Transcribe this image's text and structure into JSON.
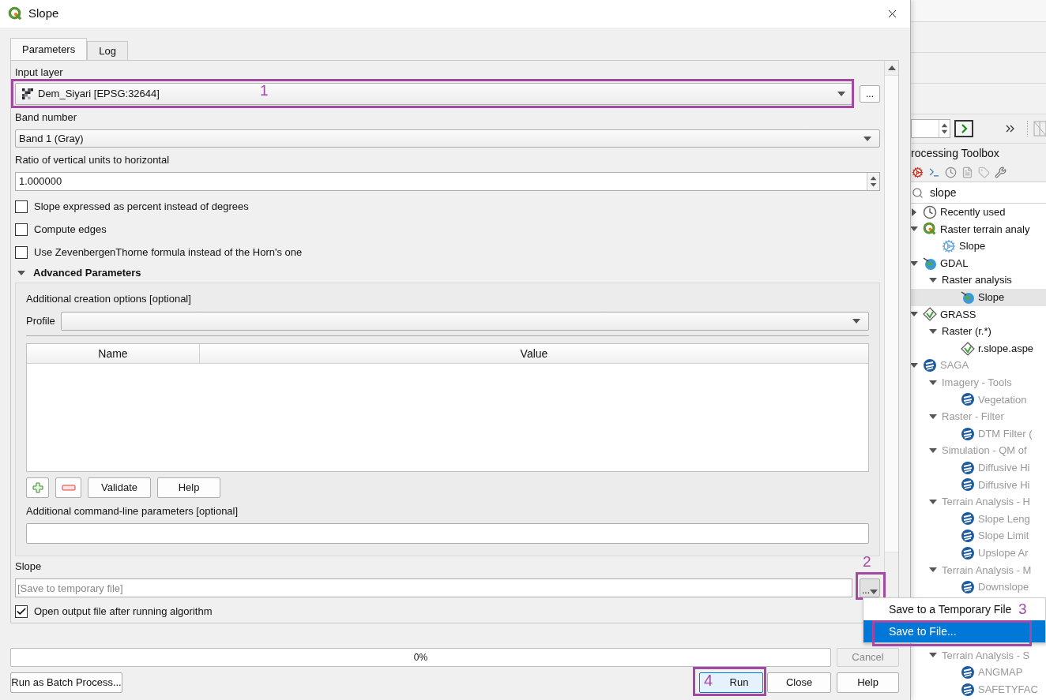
{
  "window": {
    "title": "Slope"
  },
  "tabs": [
    {
      "label": "Parameters",
      "selected": true
    },
    {
      "label": "Log",
      "selected": false
    }
  ],
  "input_layer": {
    "label": "Input layer",
    "value": "Dem_Siyari [EPSG:32644]",
    "button": "...",
    "annotation": "1"
  },
  "band": {
    "label": "Band number",
    "value": "Band 1 (Gray)"
  },
  "ratio": {
    "label": "Ratio of vertical units to horizontal",
    "value": "1.000000"
  },
  "options": [
    {
      "label": "Slope expressed as percent instead of degrees",
      "checked": false
    },
    {
      "label": "Compute edges",
      "checked": false
    },
    {
      "label": "Use ZevenbergenThorne formula instead of the Horn's one",
      "checked": false
    }
  ],
  "advanced": {
    "title": "Advanced Parameters",
    "expanded": true,
    "creation_label": "Additional creation options [optional]",
    "profile_label": "Profile",
    "columns": [
      "Name",
      "Value"
    ],
    "buttons": [
      "Validate",
      "Help"
    ],
    "cmdline_label": "Additional command-line parameters [optional]"
  },
  "output": {
    "label": "Slope",
    "placeholder": "[Save to temporary file]",
    "button": "...",
    "annotation": "2",
    "open_after": {
      "label": "Open output file after running algorithm",
      "checked": true
    }
  },
  "menu": {
    "items": [
      {
        "label": "Save to a Temporary File",
        "selected": false,
        "annotation": "3"
      },
      {
        "label": "Save to File...",
        "selected": true
      }
    ]
  },
  "progress": {
    "level": 0,
    "text": "0%"
  },
  "cancel": {
    "label": "Cancel",
    "disabled": true
  },
  "batch_button": "Run as Batch Process...",
  "actions": [
    {
      "label": "Run",
      "annotation": "4"
    },
    {
      "label": "Close"
    },
    {
      "label": "Help"
    }
  ],
  "toolbox": {
    "title": "rocessing Toolbox",
    "search": "slope",
    "tree": [
      {
        "label": "Recently used",
        "kind": "clock",
        "expanded": false,
        "disabled": false,
        "selected": false
      },
      {
        "label": "Raster terrain analy",
        "kind": "qgis",
        "expanded": true,
        "disabled": false,
        "selected": false,
        "children": [
          {
            "label": "Slope",
            "kind": "gear",
            "disabled": false,
            "selected": false
          }
        ]
      },
      {
        "label": "GDAL",
        "kind": "gdal",
        "expanded": true,
        "disabled": false,
        "selected": false,
        "children": [
          {
            "label": "Raster analysis",
            "expanded": true,
            "disabled": false,
            "selected": false,
            "children": [
              {
                "label": "Slope",
                "kind": "gdal",
                "disabled": false,
                "selected": true
              }
            ]
          }
        ]
      },
      {
        "label": "GRASS",
        "kind": "grass",
        "expanded": true,
        "disabled": false,
        "selected": false,
        "children": [
          {
            "label": "Raster (r.*)",
            "expanded": true,
            "disabled": false,
            "selected": false,
            "children": [
              {
                "label": "r.slope.aspe",
                "kind": "grass",
                "disabled": false,
                "selected": false
              }
            ]
          }
        ]
      },
      {
        "label": "SAGA",
        "kind": "saga",
        "expanded": true,
        "disabled": true,
        "selected": false,
        "children": [
          {
            "label": "Imagery - Tools",
            "expanded": true,
            "disabled": true,
            "selected": false,
            "children": [
              {
                "label": "Vegetation",
                "kind": "saga",
                "disabled": true,
                "selected": false
              }
            ]
          },
          {
            "label": "Raster - Filter",
            "expanded": true,
            "disabled": true,
            "selected": false,
            "children": [
              {
                "label": "DTM Filter (",
                "kind": "saga",
                "disabled": true,
                "selected": false
              }
            ]
          },
          {
            "label": "Simulation - QM of",
            "expanded": true,
            "disabled": true,
            "selected": false,
            "children": [
              {
                "label": "Diffusive Hi",
                "kind": "saga",
                "disabled": true,
                "selected": false
              },
              {
                "label": "Diffusive Hi",
                "kind": "saga",
                "disabled": true,
                "selected": false
              }
            ]
          },
          {
            "label": "Terrain Analysis - H",
            "expanded": true,
            "disabled": true,
            "selected": false,
            "children": [
              {
                "label": "Slope Leng",
                "kind": "saga",
                "disabled": true,
                "selected": false
              },
              {
                "label": "Slope Limit",
                "kind": "saga",
                "disabled": true,
                "selected": false
              },
              {
                "label": "Upslope Ar",
                "kind": "saga",
                "disabled": true,
                "selected": false
              }
            ]
          },
          {
            "label": "Terrain Analysis - M",
            "expanded": true,
            "disabled": true,
            "selected": false,
            "children": [
              {
                "label": "Downslope",
                "kind": "saga",
                "disabled": true,
                "selected": false
              }
            ]
          },
          {
            "label": "Terrain Analysis - S",
            "expanded": true,
            "disabled": true,
            "selected": false,
            "children": [
              {
                "label": "ANGMAP",
                "kind": "saga",
                "disabled": true,
                "selected": false
              },
              {
                "label": "SAFETYFAC",
                "kind": "saga",
                "disabled": true,
                "selected": false
              }
            ]
          }
        ]
      }
    ]
  }
}
